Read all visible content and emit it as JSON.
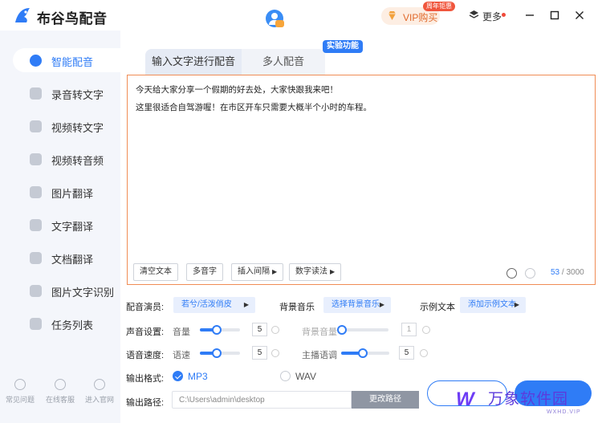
{
  "app": {
    "title": "布谷鸟配音"
  },
  "header": {
    "vip_label": "VIP购买",
    "vip_tag": "周年钜惠",
    "more_label": "更多"
  },
  "sidebar": {
    "items": [
      {
        "label": "智能配音",
        "active": true
      },
      {
        "label": "录音转文字"
      },
      {
        "label": "视频转文字"
      },
      {
        "label": "视频转音频"
      },
      {
        "label": "图片翻译"
      },
      {
        "label": "文字翻译"
      },
      {
        "label": "文档翻译"
      },
      {
        "label": "图片文字识别"
      },
      {
        "label": "任务列表"
      }
    ],
    "bottom": [
      {
        "label": "常见问题"
      },
      {
        "label": "在线客服"
      },
      {
        "label": "进入官网"
      }
    ]
  },
  "tabs": {
    "items": [
      {
        "label": "输入文字进行配音",
        "active": true
      },
      {
        "label": "多人配音"
      }
    ],
    "badge": "实验功能"
  },
  "editor": {
    "lines": [
      "今天给大家分享一个假期的好去处，大家快跟我来吧！",
      "这里很适合自驾游喔！在市区开车只需要大概半个小时的车程。"
    ],
    "buttons": {
      "clear": "清空文本",
      "polyphone": "多音字",
      "insert_pause": "插入间隔",
      "number_reading": "数字读法"
    },
    "count_current": "53",
    "count_sep": " / ",
    "count_max": "3000"
  },
  "controls": {
    "voice_label": "配音演员:",
    "voice_value": "若兮/活泼俏皮",
    "bgm_label": "背景音乐",
    "bgm_value": "选择背景音乐",
    "sample_label": "示例文本",
    "sample_value": "添加示例文本",
    "sound_label": "声音设置:",
    "volume_label": "音量",
    "volume_value": "5",
    "bg_volume_label": "背景音量",
    "bg_volume_value": "1",
    "speed_label": "语音速度:",
    "rate_label": "语速",
    "rate_value": "5",
    "tone_label": "主播语调",
    "tone_value": "5",
    "format_label": "输出格式:",
    "format_mp3": "MP3",
    "format_wav": "WAV",
    "selected_format": "MP3",
    "path_label": "输出路径:",
    "path_value": "C:\\Users\\admin\\desktop",
    "change_path": "更改路径"
  },
  "watermark": {
    "logo": "W",
    "text": "万象软件园",
    "sub": "WXHD.VIP"
  },
  "colors": {
    "accent": "#2f7cf6",
    "editor_border": "#f08c55",
    "sidebar_bg": "#f4f6fb",
    "vip": "#e0692a"
  }
}
